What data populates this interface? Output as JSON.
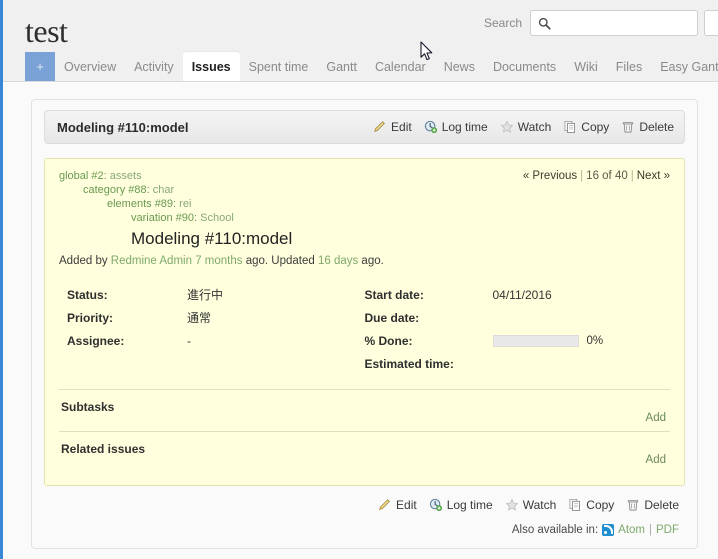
{
  "header": {
    "project_title": "test",
    "search_label": "Search",
    "search_value": "",
    "search_placeholder": ""
  },
  "nav": {
    "plus_label": "+",
    "items": [
      {
        "label": "Overview",
        "active": false
      },
      {
        "label": "Activity",
        "active": false
      },
      {
        "label": "Issues",
        "active": true
      },
      {
        "label": "Spent time",
        "active": false
      },
      {
        "label": "Gantt",
        "active": false
      },
      {
        "label": "Calendar",
        "active": false
      },
      {
        "label": "News",
        "active": false
      },
      {
        "label": "Documents",
        "active": false
      },
      {
        "label": "Wiki",
        "active": false
      },
      {
        "label": "Files",
        "active": false
      },
      {
        "label": "Easy Gantt",
        "active": false
      }
    ]
  },
  "issue": {
    "header_title": "Modeling #110:model",
    "subject": "Modeling #110:model",
    "breadcrumb": [
      {
        "prefix": "global #2",
        "sep": ": ",
        "name": "assets",
        "level": 0
      },
      {
        "prefix": "category #88",
        "sep": ": ",
        "name": "char",
        "level": 1
      },
      {
        "prefix": "elements #89",
        "sep": ": ",
        "name": "rei",
        "level": 2
      },
      {
        "prefix": "variation #90",
        "sep": ": ",
        "name": "School",
        "level": 3
      }
    ],
    "pager": {
      "previous": "« Previous",
      "position": "16 of 40",
      "next": "Next »"
    },
    "added_by": {
      "prefix": "Added by ",
      "author": "Redmine Admin",
      "created_ago": "7 months",
      "mid": " ago. Updated ",
      "updated_ago": "16 days",
      "suffix": " ago."
    },
    "attributes_left": [
      {
        "label": "Status:",
        "value": "進行中"
      },
      {
        "label": "Priority:",
        "value": "通常"
      },
      {
        "label": "Assignee:",
        "value": "-"
      }
    ],
    "attributes_right": [
      {
        "label": "Start date:",
        "value": "04/11/2016"
      },
      {
        "label": "Due date:",
        "value": ""
      },
      {
        "label": "% Done:",
        "value": "",
        "progress": 0,
        "progress_text": "0%"
      },
      {
        "label": "Estimated time:",
        "value": ""
      }
    ],
    "sections": [
      {
        "title": "Subtasks",
        "add_label": "Add"
      },
      {
        "title": "Related issues",
        "add_label": "Add"
      }
    ]
  },
  "actions": [
    {
      "label": "Edit",
      "icon": "pencil-icon"
    },
    {
      "label": "Log time",
      "icon": "clock-add-icon"
    },
    {
      "label": "Watch",
      "icon": "star-icon"
    },
    {
      "label": "Copy",
      "icon": "copy-icon"
    },
    {
      "label": "Delete",
      "icon": "trash-icon"
    }
  ],
  "footer": {
    "also_available_label": "Also available in:",
    "atom_label": "Atom",
    "separator": "|",
    "pdf_label": "PDF"
  },
  "colors": {
    "accent_blue": "#3a86d6",
    "issue_bg": "#ffffdd",
    "link_green": "#7fa96b",
    "nav_plus": "#7ba2d6"
  }
}
